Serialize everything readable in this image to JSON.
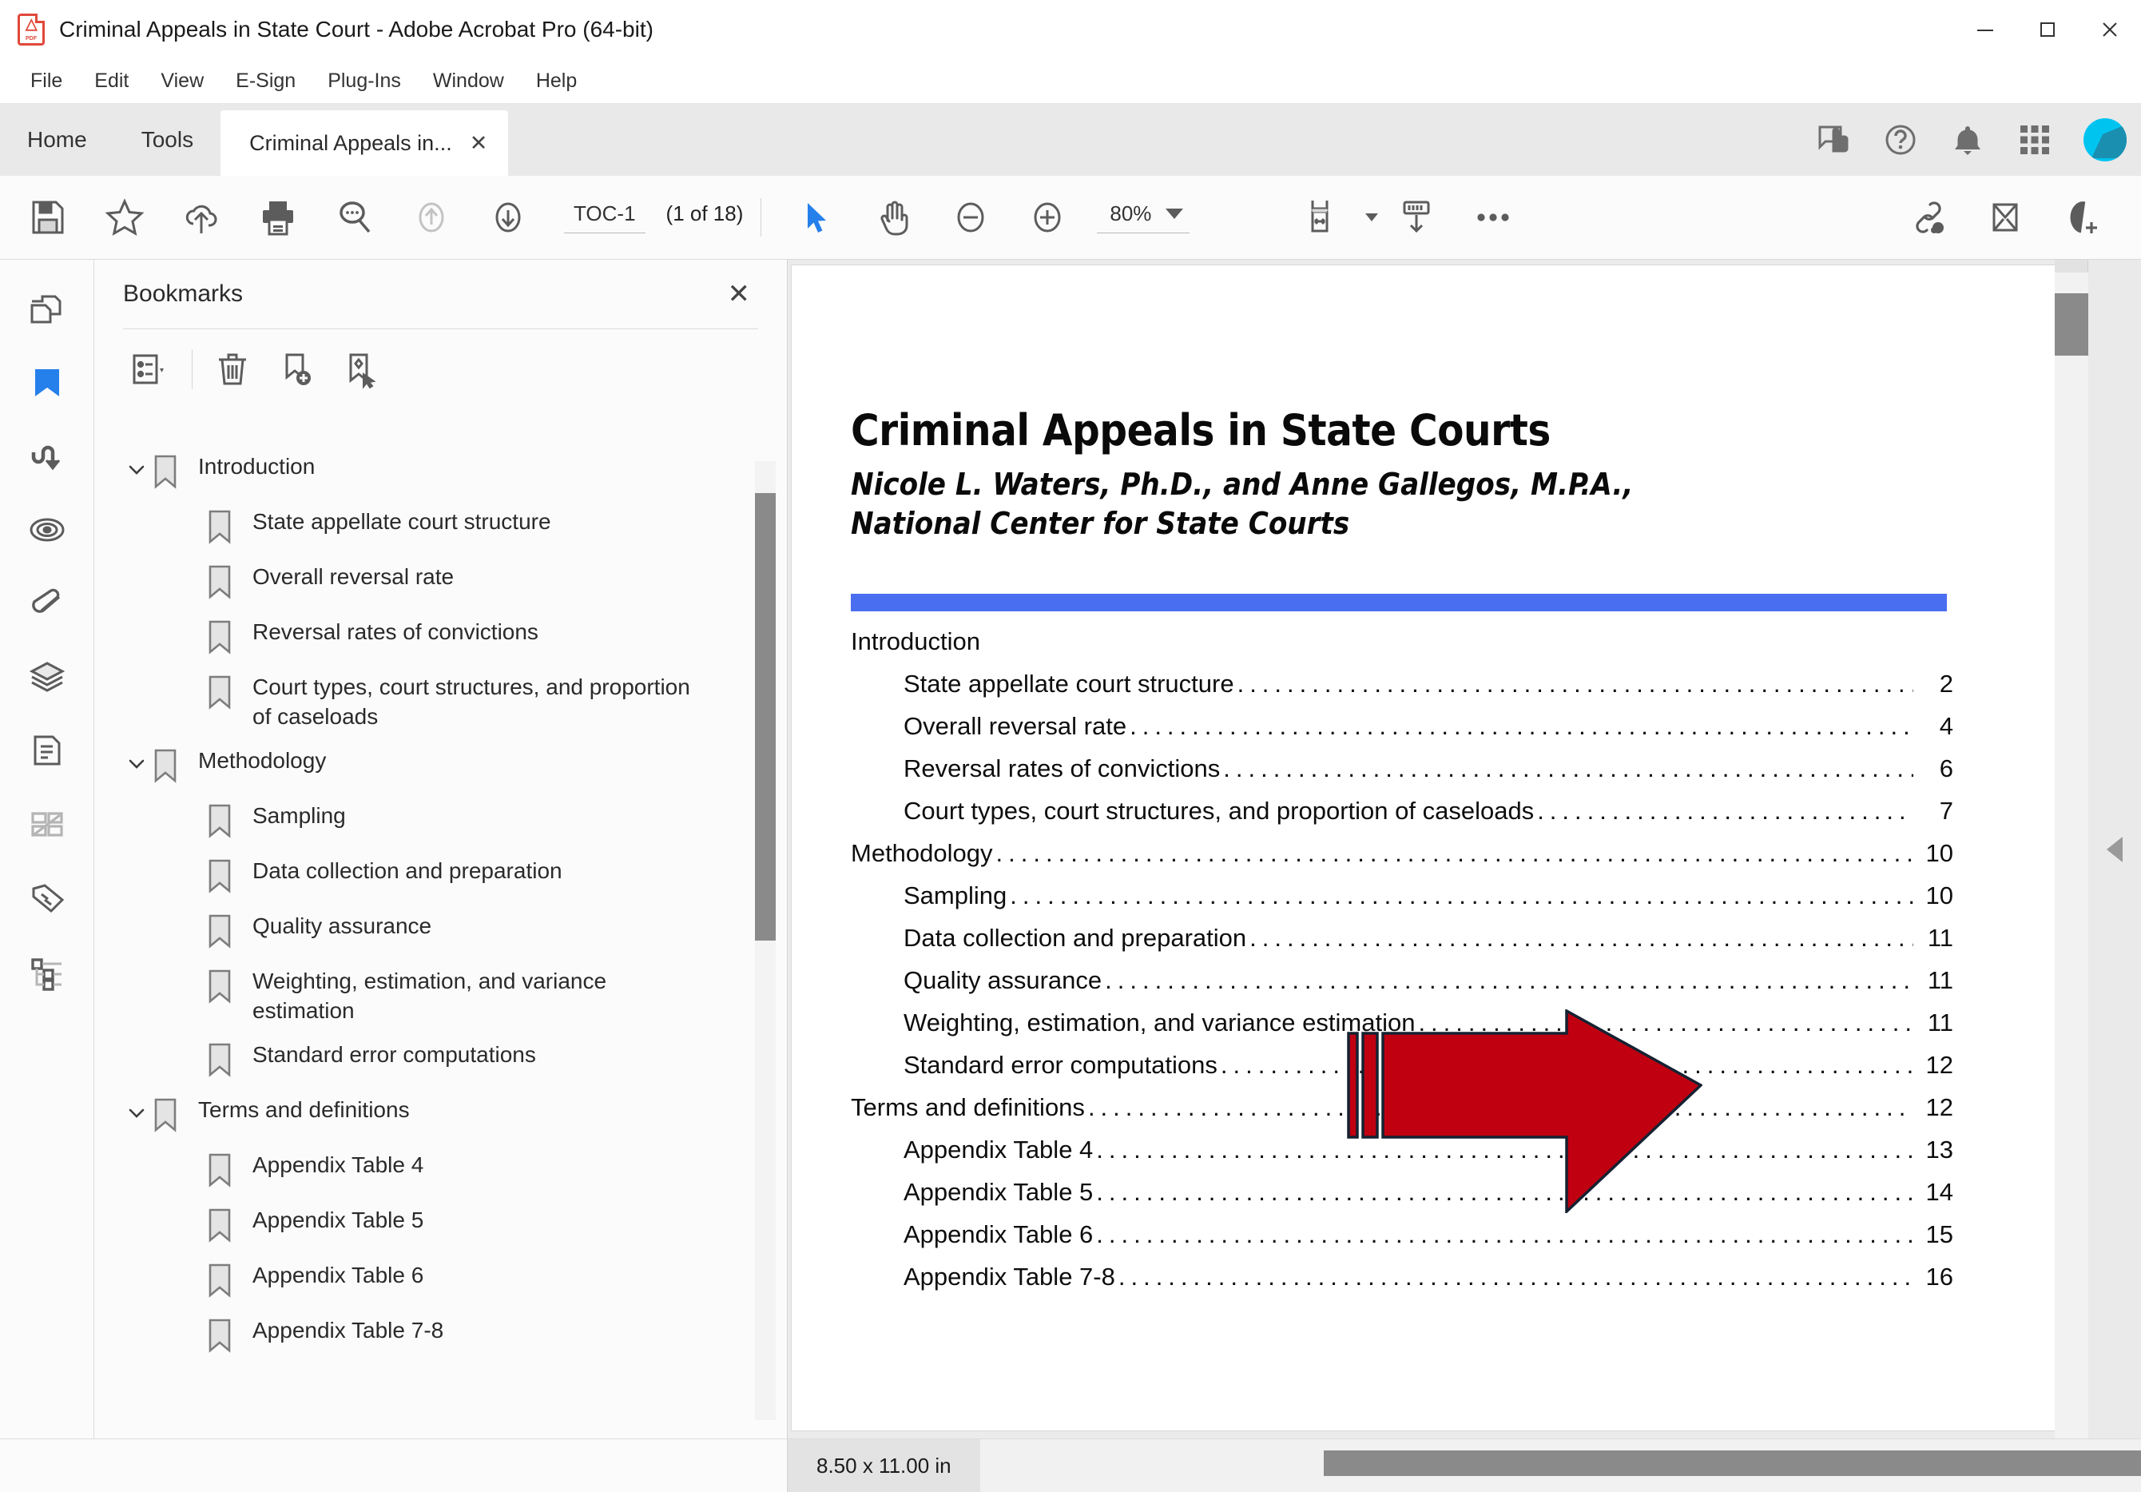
{
  "window": {
    "title": "Criminal Appeals in State Court - Adobe Acrobat Pro (64-bit)",
    "app_icon": "pdf-file-icon",
    "minimize_label": "–",
    "maximize_label": "□",
    "close_label": "✕"
  },
  "menubar": {
    "items": [
      {
        "label": "File"
      },
      {
        "label": "Edit"
      },
      {
        "label": "View"
      },
      {
        "label": "E-Sign"
      },
      {
        "label": "Plug-Ins"
      },
      {
        "label": "Window"
      },
      {
        "label": "Help"
      }
    ]
  },
  "tabbar": {
    "home_label": "Home",
    "tools_label": "Tools",
    "document_tab_label": "Criminal Appeals in...",
    "document_tab_close": "✕",
    "right_icons": [
      {
        "name": "feedback-icon"
      },
      {
        "name": "help-icon"
      },
      {
        "name": "notifications-bell-icon"
      },
      {
        "name": "app-grid-icon"
      },
      {
        "name": "user-avatar"
      }
    ]
  },
  "toolbar": {
    "icons_left": [
      {
        "name": "save-icon"
      },
      {
        "name": "star-favorite-icon"
      },
      {
        "name": "cloud-upload-icon"
      },
      {
        "name": "print-icon"
      },
      {
        "name": "search-icon"
      },
      {
        "name": "previous-page-icon"
      },
      {
        "name": "next-page-icon"
      }
    ],
    "page_value": "TOC-1",
    "page_count": "(1 of 18)",
    "tools": [
      {
        "name": "select-cursor-icon"
      },
      {
        "name": "hand-tool-icon"
      },
      {
        "name": "zoom-out-icon"
      },
      {
        "name": "zoom-in-icon"
      }
    ],
    "zoom_value": "80%",
    "icons_right": [
      {
        "name": "page-fit-icon"
      },
      {
        "name": "scroll-mode-icon"
      },
      {
        "name": "more-options-icon"
      }
    ],
    "icons_far_right": [
      {
        "name": "share-link-icon"
      },
      {
        "name": "email-icon"
      },
      {
        "name": "add-user-icon"
      }
    ]
  },
  "rail": {
    "items": [
      {
        "name": "page-thumbnails-icon",
        "active": false
      },
      {
        "name": "bookmarks-icon",
        "active": true
      },
      {
        "name": "links-navigation-icon",
        "active": false
      },
      {
        "name": "destinations-icon",
        "active": false
      },
      {
        "name": "attachments-icon",
        "active": false
      },
      {
        "name": "layers-icon",
        "active": false
      },
      {
        "name": "content-icon",
        "active": false
      },
      {
        "name": "accessibility-tags-icon",
        "active": false
      },
      {
        "name": "stamps-tags-icon",
        "active": false
      },
      {
        "name": "structure-tree-icon",
        "active": false
      }
    ]
  },
  "bookmarks_panel": {
    "title": "Bookmarks",
    "close_label": "✕",
    "toolbar_icons": [
      {
        "name": "bookmark-options-icon"
      },
      {
        "name": "delete-bookmark-icon"
      },
      {
        "name": "new-bookmark-icon"
      },
      {
        "name": "set-bookmark-destination-icon"
      }
    ],
    "tree": [
      {
        "label": "Introduction",
        "level": 1,
        "expanded": true
      },
      {
        "label": "State appellate court structure",
        "level": 2,
        "expanded": false
      },
      {
        "label": "Overall reversal rate",
        "level": 2,
        "expanded": false
      },
      {
        "label": "Reversal rates of convictions",
        "level": 2,
        "expanded": false
      },
      {
        "label": "Court types, court structures, and proportion of caseloads",
        "level": 2,
        "expanded": false
      },
      {
        "label": "Methodology",
        "level": 1,
        "expanded": true
      },
      {
        "label": "Sampling",
        "level": 2,
        "expanded": false
      },
      {
        "label": "Data collection and preparation",
        "level": 2,
        "expanded": false
      },
      {
        "label": "Quality assurance",
        "level": 2,
        "expanded": false
      },
      {
        "label": "Weighting, estimation, and variance estimation",
        "level": 2,
        "expanded": false
      },
      {
        "label": "Standard error computations",
        "level": 2,
        "expanded": false
      },
      {
        "label": "Terms and definitions",
        "level": 1,
        "expanded": true
      },
      {
        "label": "Appendix Table 4",
        "level": 2,
        "expanded": false
      },
      {
        "label": "Appendix Table 5",
        "level": 2,
        "expanded": false
      },
      {
        "label": "Appendix Table 6",
        "level": 2,
        "expanded": false
      },
      {
        "label": "Appendix Table 7-8",
        "level": 2,
        "expanded": false
      }
    ]
  },
  "document": {
    "title": "Criminal Appeals in State Courts",
    "authors_line1": "Nicole L. Waters, Ph.D., and Anne Gallegos, M.P.A.,",
    "authors_line2": "National Center for State Courts",
    "accent_bar_color": "#4a6ef0",
    "toc": [
      {
        "label": "Introduction",
        "page": "",
        "level": 0,
        "dots": false
      },
      {
        "label": "State appellate court structure",
        "page": "2",
        "level": 1,
        "dots": true
      },
      {
        "label": "Overall reversal rate",
        "page": "4",
        "level": 1,
        "dots": true
      },
      {
        "label": "Reversal rates of convictions",
        "page": "6",
        "level": 1,
        "dots": true
      },
      {
        "label": "Court types, court structures, and proportion of caseloads",
        "page": "7",
        "level": 1,
        "dots": true
      },
      {
        "label": "Methodology",
        "page": "10",
        "level": 0,
        "dots": true
      },
      {
        "label": "Sampling",
        "page": "10",
        "level": 1,
        "dots": true
      },
      {
        "label": "Data collection and preparation",
        "page": "11",
        "level": 1,
        "dots": true
      },
      {
        "label": "Quality assurance",
        "page": "11",
        "level": 1,
        "dots": true
      },
      {
        "label": "Weighting, estimation, and variance estimation",
        "page": "11",
        "level": 1,
        "dots": true
      },
      {
        "label": "Standard error computations",
        "page": "12",
        "level": 1,
        "dots": true
      },
      {
        "label": "Terms and definitions",
        "page": "12",
        "level": 0,
        "dots": true
      },
      {
        "label": "Appendix Table 4",
        "page": "13",
        "level": 1,
        "dots": true
      },
      {
        "label": "Appendix Table 5",
        "page": "14",
        "level": 1,
        "dots": true
      },
      {
        "label": "Appendix Table 6",
        "page": "15",
        "level": 1,
        "dots": true
      },
      {
        "label": "Appendix Table 7-8",
        "page": "16",
        "level": 1,
        "dots": true
      }
    ]
  },
  "annotation": {
    "name": "red-arrow-annotation",
    "fill_color": "#c00010",
    "stroke_color": "#152232"
  },
  "statusbar": {
    "page_size": "8.50 x 11.00 in"
  }
}
